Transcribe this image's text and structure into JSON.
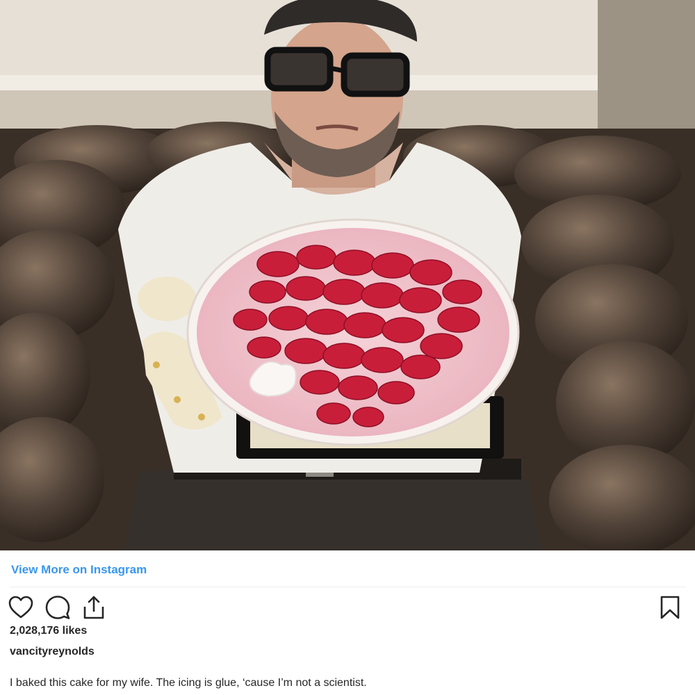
{
  "post": {
    "image": {
      "icon": "photo-man-with-strawberry-cake",
      "colors": {
        "sofa": "#4a3d33",
        "wall": "#e9e4dc",
        "shirt": "#f2f0ec",
        "plate": "#f6f1ee",
        "icing": "#f2c6cf",
        "strawberry": "#c81e3a"
      }
    },
    "view_more_label": "View More on Instagram",
    "actions": {
      "like_icon": "heart-icon",
      "comment_icon": "comment-icon",
      "share_icon": "share-icon",
      "save_icon": "bookmark-icon"
    },
    "likes_text": "2,028,176 likes",
    "username": "vancityreynolds",
    "caption": "I baked this cake for my wife. The icing is glue, ‘cause I’m not a scientist.",
    "colors": {
      "link": "#3897f0",
      "text": "#262626",
      "divider": "#efefef"
    }
  }
}
